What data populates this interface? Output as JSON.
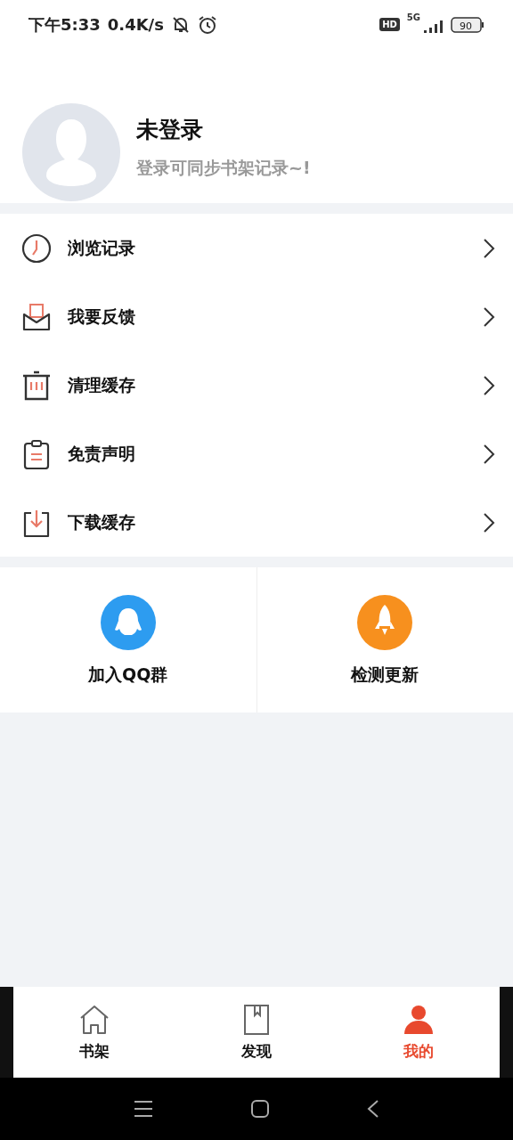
{
  "status_bar": {
    "time": "下午5:33",
    "speed": "0.4K/s",
    "hd": "HD",
    "network": "5G",
    "battery": "90"
  },
  "profile": {
    "name": "未登录",
    "hint": "登录可同步书架记录~!"
  },
  "menu": [
    {
      "kind": "history",
      "label": "浏览记录"
    },
    {
      "kind": "feedback",
      "label": "我要反馈"
    },
    {
      "kind": "clear",
      "label": "清理缓存"
    },
    {
      "kind": "disclaimer",
      "label": "免责声明"
    },
    {
      "kind": "download",
      "label": "下载缓存"
    }
  ],
  "actions": [
    {
      "kind": "qq",
      "label": "加入QQ群",
      "color": "#2d9cf0"
    },
    {
      "kind": "update",
      "label": "检测更新",
      "color": "#f7901e"
    }
  ],
  "tabs": [
    {
      "kind": "shelf",
      "label": "书架",
      "selected": false
    },
    {
      "kind": "discover",
      "label": "发现",
      "selected": false
    },
    {
      "kind": "mine",
      "label": "我的",
      "selected": true
    }
  ]
}
